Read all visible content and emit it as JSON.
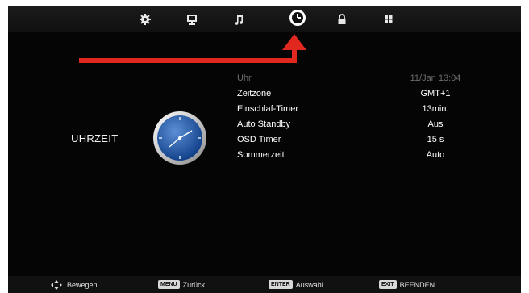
{
  "topbar": {
    "icons": [
      "gear-icon",
      "monitor-icon",
      "music-note-icon",
      "clock-icon",
      "lock-icon",
      "grid-icon"
    ],
    "active": "clock-icon"
  },
  "section_title": "UHRZEIT",
  "settings": [
    {
      "label": "Uhr",
      "value": "11/Jan   13:04",
      "state": "disabled"
    },
    {
      "label": "Zeitzone",
      "value": "GMT+1"
    },
    {
      "label": "Einschlaf-Timer",
      "value": "13min."
    },
    {
      "label": "Auto Standby",
      "value": "Aus"
    },
    {
      "label": "OSD Timer",
      "value": "15 s"
    },
    {
      "label": "Sommerzeit",
      "value": "Auto"
    }
  ],
  "bottombar": {
    "move": {
      "key_icon": "dpad-arrows-icon",
      "label": "Bewegen"
    },
    "back": {
      "key": "MENU",
      "label": "Zurück"
    },
    "select": {
      "key": "ENTER",
      "label": "Auswahl"
    },
    "exit": {
      "key": "EXIT",
      "label": "BEENDEN"
    }
  },
  "colors": {
    "arrow": "#e0281e",
    "background": "#050505",
    "disabled_text": "#6e6e6e"
  }
}
